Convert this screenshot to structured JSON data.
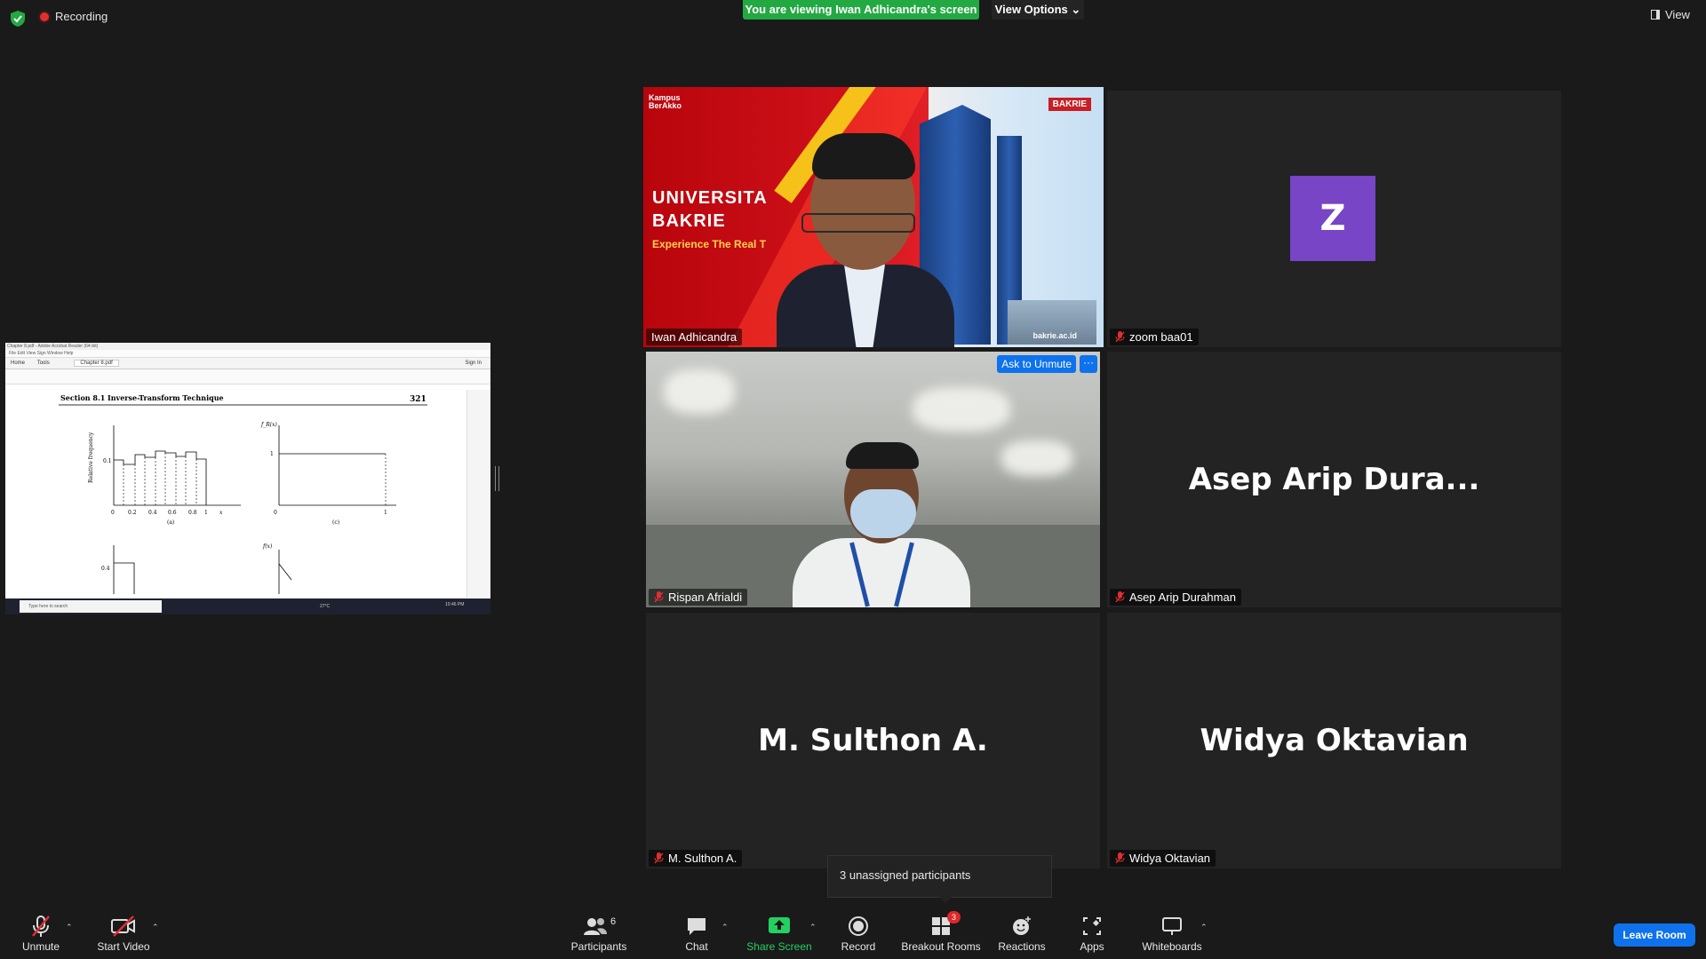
{
  "topbar": {
    "recording": "Recording",
    "viewing_banner": "You are viewing Iwan Adhicandra's screen",
    "view_options": "View Options",
    "view": "View"
  },
  "tiles": {
    "iwan": {
      "name": "Iwan Adhicandra"
    },
    "zoom": {
      "name": "zoom baa01",
      "avatar": "Z"
    },
    "rispan": {
      "name": "Rispan Afrialdi",
      "ask_unmute": "Ask to Unmute",
      "more": "···"
    },
    "asep": {
      "name": "Asep Arip Durahman",
      "display": "Asep Arip Dura..."
    },
    "sulthon": {
      "name": "M. Sulthon A.",
      "display": "M. Sulthon A."
    },
    "widya": {
      "name": "Widya Oktavian",
      "display": "Widya Oktavian"
    }
  },
  "speaker_video": {
    "kampus": "Kampus\nBerAkko",
    "univ_line1": "UNIVERSITA",
    "univ_line2": "BAKRIE",
    "tagline": "Experience The Real T",
    "logo": "BAKRIE",
    "url": "bakrie.ac.id"
  },
  "shared_screen": {
    "title": "Chapter 8.pdf - Adobe Acrobat Reader (64-bit)",
    "menu": "File  Edit  View  Sign  Window  Help",
    "tab_home": "Home",
    "tab_tools": "Tools",
    "tab_doc": "Chapter 8.pdf",
    "sign_in": "Sign In",
    "section": "Section 8.1",
    "section_title": "Inverse-Transform Technique",
    "page_number": "321",
    "ylabel": "Relative frequency",
    "ytick": "0.1",
    "xticks": [
      "0",
      "0.2",
      "0.4",
      "0.6",
      "0.8",
      "1",
      "x"
    ],
    "label_a": "(a)",
    "label_c": "(c)",
    "fr_label": "f_R(x)",
    "f_label": "f(x)",
    "one": "1",
    "zero": "0",
    "tick_04": "0.4",
    "taskbar_search": "Type here to search",
    "weather": "27°C",
    "clock": "10:46 PM"
  },
  "toolbar": {
    "unmute": "Unmute",
    "start_video": "Start Video",
    "participants": "Participants",
    "participants_count": "6",
    "chat": "Chat",
    "share_screen": "Share Screen",
    "record": "Record",
    "breakout_rooms": "Breakout Rooms",
    "breakout_badge": "3",
    "reactions": "Reactions",
    "apps": "Apps",
    "whiteboards": "Whiteboards",
    "leave": "Leave Room"
  },
  "popup": {
    "unassigned": "3 unassigned participants"
  },
  "colors": {
    "accent": "#0e72ed",
    "green": "#23a942",
    "avatar": "#7745c5",
    "active_border": "#e3e35a",
    "mute_red": "#e02f2f"
  }
}
